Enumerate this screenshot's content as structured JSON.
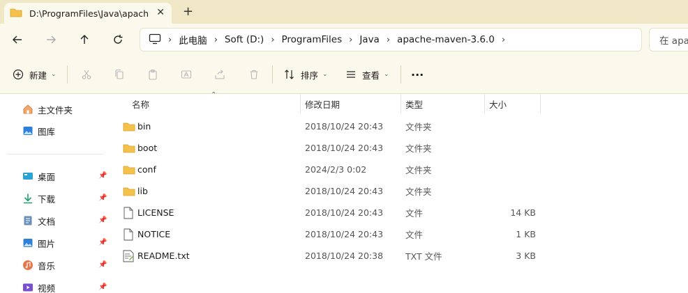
{
  "window": {
    "tab_title": "D:\\ProgramFiles\\Java\\apache-",
    "tab_close": "✕",
    "new_tab": "+"
  },
  "address": {
    "breadcrumbs": [
      "此电脑",
      "Soft (D:)",
      "ProgramFiles",
      "Java",
      "apache-maven-3.6.0"
    ],
    "separator": "›"
  },
  "search": {
    "placeholder": "在 apa"
  },
  "toolbar": {
    "new_label": "新建",
    "sort_label": "排序",
    "view_label": "查看",
    "more_label": "···"
  },
  "sidebar": {
    "quick": [
      {
        "label": "主文件夹",
        "icon": "home-icon"
      },
      {
        "label": "图库",
        "icon": "gallery-icon"
      }
    ],
    "pinned": [
      {
        "label": "桌面",
        "icon": "desktop-icon"
      },
      {
        "label": "下载",
        "icon": "download-icon"
      },
      {
        "label": "文档",
        "icon": "document-icon"
      },
      {
        "label": "图片",
        "icon": "pictures-icon"
      },
      {
        "label": "音乐",
        "icon": "music-icon"
      },
      {
        "label": "视频",
        "icon": "video-icon"
      }
    ]
  },
  "columns": {
    "name": "名称",
    "modified": "修改日期",
    "type": "类型",
    "size": "大小"
  },
  "files": [
    {
      "name": "bin",
      "modified": "2018/10/24 20:43",
      "type": "文件夹",
      "size": "",
      "icon": "folder-icon"
    },
    {
      "name": "boot",
      "modified": "2018/10/24 20:43",
      "type": "文件夹",
      "size": "",
      "icon": "folder-icon"
    },
    {
      "name": "conf",
      "modified": "2024/2/3 0:02",
      "type": "文件夹",
      "size": "",
      "icon": "folder-icon"
    },
    {
      "name": "lib",
      "modified": "2018/10/24 20:43",
      "type": "文件夹",
      "size": "",
      "icon": "folder-icon"
    },
    {
      "name": "LICENSE",
      "modified": "2018/10/24 20:43",
      "type": "文件",
      "size": "14 KB",
      "icon": "file-icon"
    },
    {
      "name": "NOTICE",
      "modified": "2018/10/24 20:43",
      "type": "文件",
      "size": "1 KB",
      "icon": "file-icon"
    },
    {
      "name": "README.txt",
      "modified": "2018/10/24 20:38",
      "type": "TXT 文件",
      "size": "3 KB",
      "icon": "text-file-icon"
    }
  ],
  "colors": {
    "chrome": "#fbf8ec",
    "tabstrip": "#efe7c6",
    "folder": "#f4c14b"
  }
}
